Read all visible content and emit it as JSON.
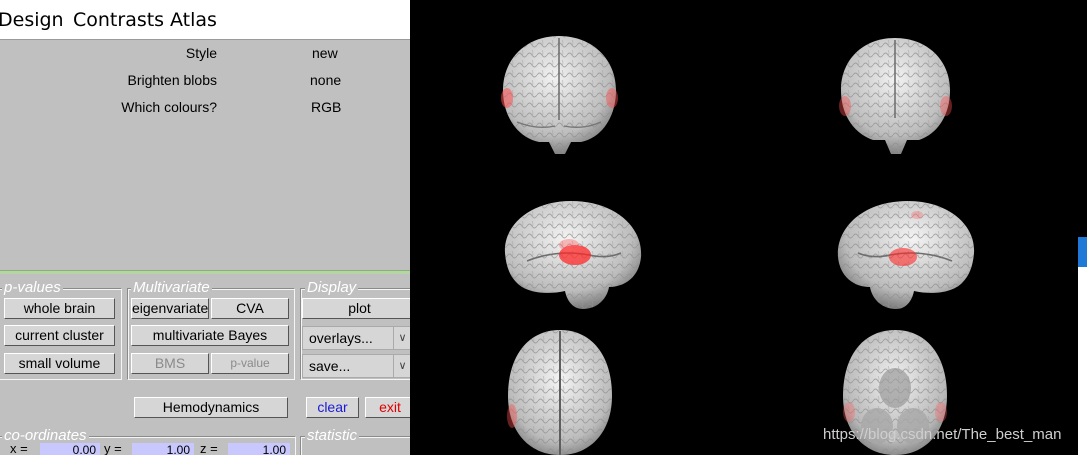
{
  "menu": [
    "Design",
    "Contrasts",
    "Atlas"
  ],
  "options": [
    {
      "label": "Style",
      "value": "new"
    },
    {
      "label": "Brighten blobs",
      "value": "none"
    },
    {
      "label": "Which colours?",
      "value": "RGB"
    }
  ],
  "groups": {
    "pvalues": "p-values",
    "multivariate": "Multivariate",
    "display": "Display",
    "coordinates": "co-ordinates",
    "statistic": "statistic"
  },
  "buttons": {
    "whole_brain": "whole brain",
    "current_cluster": "current cluster",
    "small_volume": "small volume",
    "eigenvariate": "eigenvariate",
    "cva": "CVA",
    "multivariate_bayes": "multivariate Bayes",
    "bms": "BMS",
    "pvalue": "p-value",
    "plot": "plot",
    "hemodynamics": "Hemodynamics",
    "clear": "clear",
    "exit": "exit"
  },
  "selects": {
    "overlays": "overlays...",
    "save": "save..."
  },
  "coords": {
    "x_label": "x =",
    "y_label": "y =",
    "z_label": "z =",
    "x": "0.00",
    "y": "1.00",
    "z": "1.00"
  },
  "watermark": "https://blog.csdn.net/The_best_man",
  "colors": {
    "panel_bg": "#c0c0c0",
    "render_bg": "#000000",
    "activation": "#ff3030",
    "clear_text": "#1a1ad8",
    "exit_text": "#e00000"
  }
}
